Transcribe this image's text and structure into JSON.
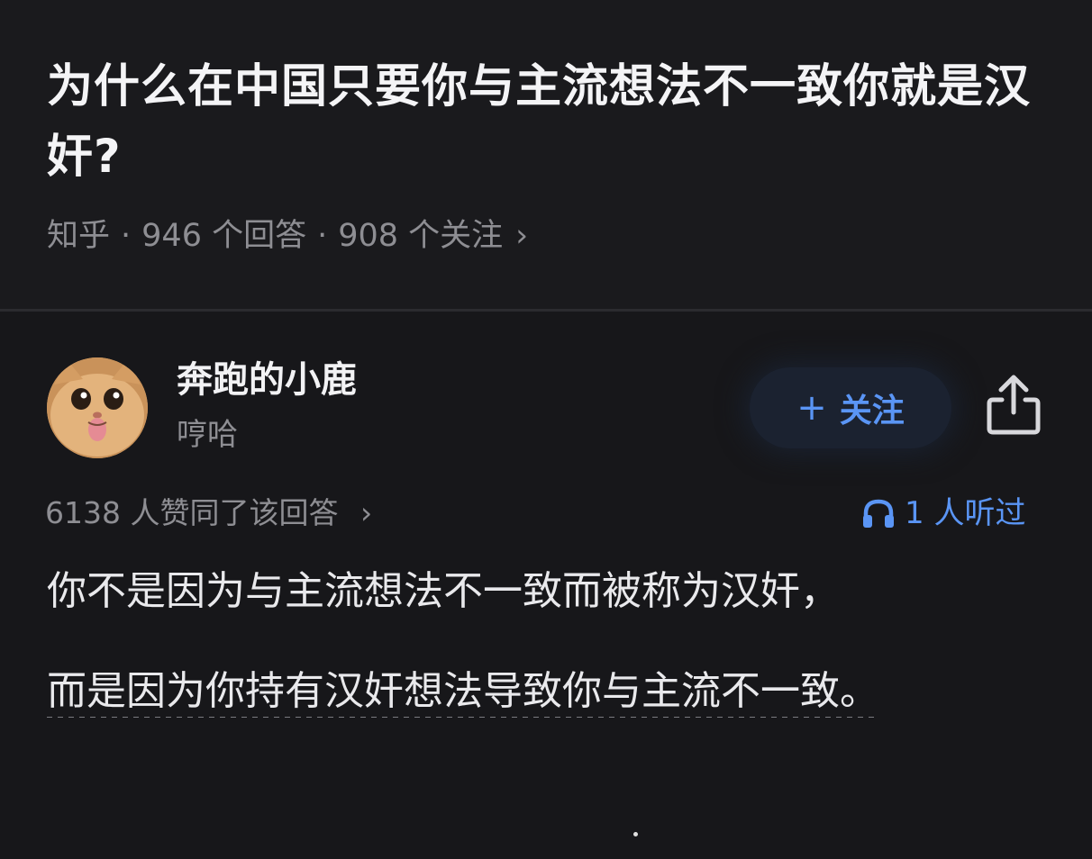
{
  "question": {
    "title": "为什么在中国只要你与主流想法不一致你就是汉奸?",
    "source": "知乎",
    "separator": "·",
    "answers_count": "946 个回答",
    "followers_count": "908 个关注",
    "chevron": "›"
  },
  "answer": {
    "author": {
      "name": "奔跑的小鹿",
      "bio": "哼哈",
      "avatar_icon": "cat-face-avatar"
    },
    "follow_button": {
      "plus": "+",
      "label": "关注"
    },
    "share_icon": "share-icon",
    "agree_text": "6138 人赞同了该回答",
    "agree_chevron": "›",
    "listen_icon": "headphones-icon",
    "listen_text": "1 人听过",
    "paragraphs": [
      "你不是因为与主流想法不一致而被称为汉奸，",
      "而是因为你持有汉奸想法导致你与主流不一致。"
    ]
  },
  "colors": {
    "background": "#17171a",
    "accent": "#5a95f5",
    "muted_text": "#8e8e93"
  }
}
